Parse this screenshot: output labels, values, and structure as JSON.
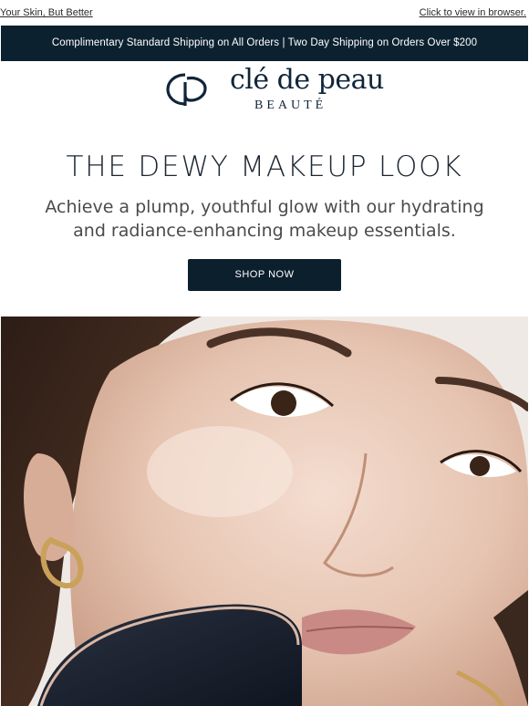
{
  "preheader": {
    "tagline": "Your Skin, But Better",
    "view_in_browser": "Click to view in browser."
  },
  "shipping_banner": {
    "text": "Complimentary Standard Shipping on All Orders | Two Day Shipping on Orders Over $200"
  },
  "brand": {
    "wordmark": "clé de peau",
    "sub": "BEAUTÉ",
    "logo_icon": "cle-de-peau-monogram-icon"
  },
  "hero_text": {
    "headline": "THE DEWY MAKEUP LOOK",
    "subhead_line1": "Achieve a plump, youthful glow with our hydrating",
    "subhead_line2": "and radiance-enhancing makeup essentials."
  },
  "cta": {
    "label": "SHOP NOW"
  },
  "hero_image": {
    "subject": "woman-face-closeup-with-compact"
  },
  "colors": {
    "navy": "#0c2130",
    "button": "#0c1f2d",
    "text": "#1d2732"
  }
}
